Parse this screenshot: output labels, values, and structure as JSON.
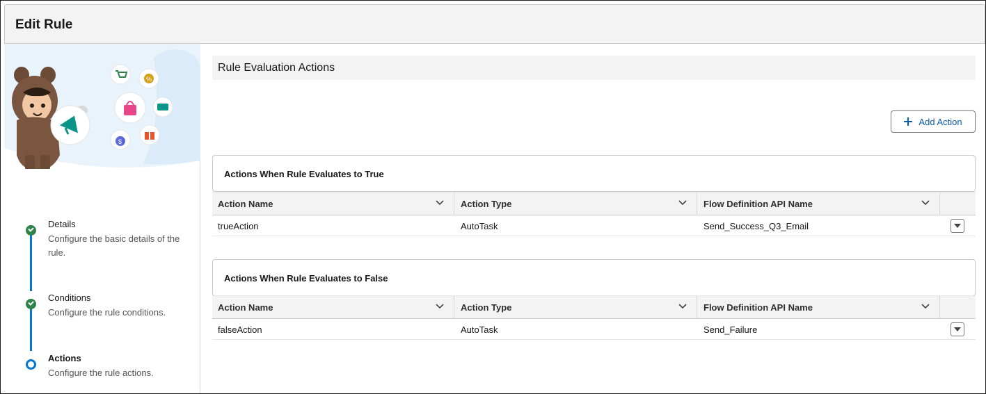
{
  "header": {
    "title": "Edit Rule"
  },
  "steps": [
    {
      "title": "Details",
      "description": "Configure the basic details of the rule.",
      "status": "complete"
    },
    {
      "title": "Conditions",
      "description": "Configure the rule conditions.",
      "status": "complete"
    },
    {
      "title": "Actions",
      "description": "Configure the rule actions.",
      "status": "current"
    }
  ],
  "main": {
    "section_title": "Rule Evaluation Actions",
    "add_action_label": "Add Action",
    "true_table": {
      "title": "Actions When Rule Evaluates to True",
      "columns": [
        "Action Name",
        "Action Type",
        "Flow Definition API Name"
      ],
      "rows": [
        {
          "action_name": "trueAction",
          "action_type": "AutoTask",
          "flow_api_name": "Send_Success_Q3_Email"
        }
      ]
    },
    "false_table": {
      "title": "Actions When Rule Evaluates to False",
      "columns": [
        "Action Name",
        "Action Type",
        "Flow Definition API Name"
      ],
      "rows": [
        {
          "action_name": "falseAction",
          "action_type": "AutoTask",
          "flow_api_name": "Send_Failure"
        }
      ]
    }
  },
  "colors": {
    "brand_blue": "#0176d3",
    "success_green": "#2e844a",
    "link_blue": "#0b5cab",
    "header_gray": "#f3f3f3"
  },
  "icons": [
    "astro-mascot-illustration",
    "megaphone-icon",
    "cart-icon",
    "percent-icon",
    "shopping-bag-icon",
    "ticket-icon",
    "money-bag-icon",
    "gift-icon",
    "plus-icon",
    "chevron-down-icon",
    "row-menu-icon"
  ]
}
